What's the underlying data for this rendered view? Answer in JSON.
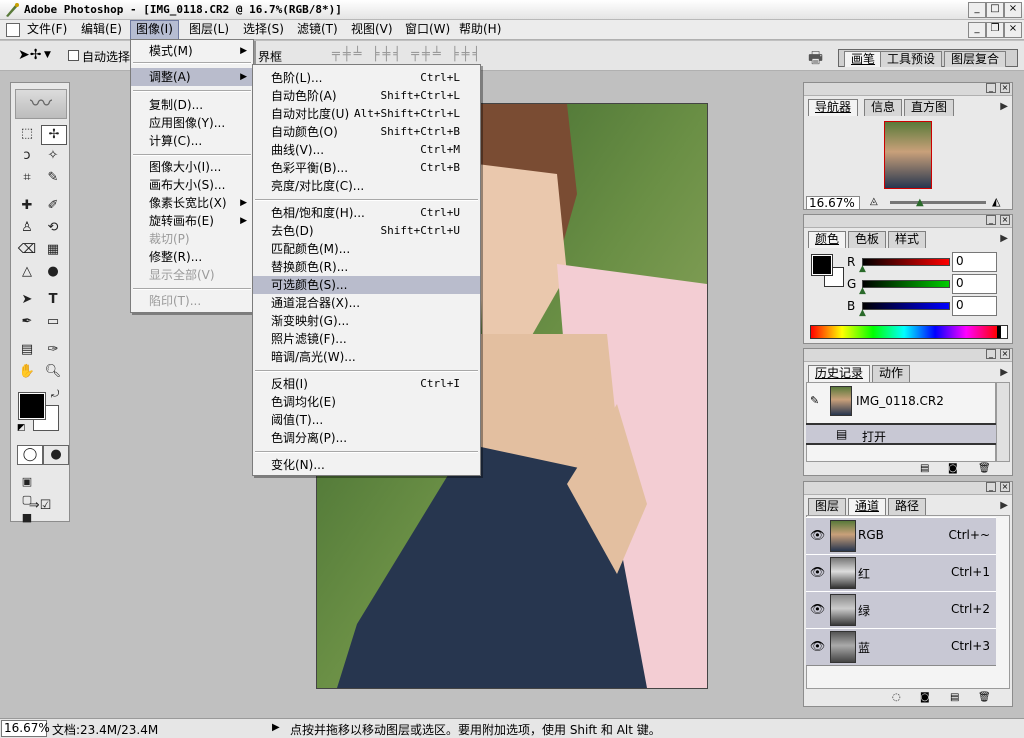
{
  "window": {
    "title": "Adobe Photoshop - [IMG_0118.CR2 @ 16.7%(RGB/8*)]"
  },
  "menubar": [
    {
      "label": "文件(F)"
    },
    {
      "label": "编辑(E)"
    },
    {
      "label": "图像(I)"
    },
    {
      "label": "图层(L)"
    },
    {
      "label": "选择(S)"
    },
    {
      "label": "滤镜(T)"
    },
    {
      "label": "视图(V)"
    },
    {
      "label": "窗口(W)"
    },
    {
      "label": "帮助(H)"
    }
  ],
  "options_bar": {
    "auto_select_label": "自动选择",
    "bounding_box_label": "界框"
  },
  "image_menu": {
    "items": [
      {
        "label": "模式(M)",
        "submenu": true
      },
      {
        "label": "调整(A)",
        "submenu": true,
        "selected": true
      },
      {
        "label": "复制(D)..."
      },
      {
        "label": "应用图像(Y)..."
      },
      {
        "label": "计算(C)..."
      },
      {
        "label": "图像大小(I)..."
      },
      {
        "label": "画布大小(S)..."
      },
      {
        "label": "像素长宽比(X)",
        "submenu": true
      },
      {
        "label": "旋转画布(E)",
        "submenu": true
      },
      {
        "label": "裁切(P)",
        "disabled": true
      },
      {
        "label": "修整(R)..."
      },
      {
        "label": "显示全部(V)",
        "disabled": true
      },
      {
        "label": "陷印(T)...",
        "disabled": true
      }
    ]
  },
  "adjust_menu": {
    "items": [
      {
        "label": "色阶(L)...",
        "shortcut": "Ctrl+L"
      },
      {
        "label": "自动色阶(A)",
        "shortcut": "Shift+Ctrl+L"
      },
      {
        "label": "自动对比度(U)",
        "shortcut": "Alt+Shift+Ctrl+L"
      },
      {
        "label": "自动颜色(O)",
        "shortcut": "Shift+Ctrl+B"
      },
      {
        "label": "曲线(V)...",
        "shortcut": "Ctrl+M"
      },
      {
        "label": "色彩平衡(B)...",
        "shortcut": "Ctrl+B"
      },
      {
        "label": "亮度/对比度(C)..."
      },
      {
        "label": "色相/饱和度(H)...",
        "shortcut": "Ctrl+U"
      },
      {
        "label": "去色(D)",
        "shortcut": "Shift+Ctrl+U"
      },
      {
        "label": "匹配颜色(M)..."
      },
      {
        "label": "替换颜色(R)..."
      },
      {
        "label": "可选颜色(S)...",
        "selected": true
      },
      {
        "label": "通道混合器(X)..."
      },
      {
        "label": "渐变映射(G)..."
      },
      {
        "label": "照片滤镜(F)..."
      },
      {
        "label": "暗调/高光(W)..."
      },
      {
        "label": "反相(I)",
        "shortcut": "Ctrl+I"
      },
      {
        "label": "色调均化(E)"
      },
      {
        "label": "阈值(T)..."
      },
      {
        "label": "色调分离(P)..."
      },
      {
        "label": "变化(N)..."
      }
    ]
  },
  "top_right_tabs": [
    "画笔",
    "工具预设",
    "图层复合"
  ],
  "navigator": {
    "tabs": [
      "导航器",
      "信息",
      "直方图"
    ],
    "zoom": "16.67%"
  },
  "color": {
    "tabs": [
      "颜色",
      "色板",
      "样式"
    ],
    "r_label": "R",
    "g_label": "G",
    "b_label": "B",
    "r": "0",
    "g": "0",
    "b": "0"
  },
  "history": {
    "tabs": [
      "历史记录",
      "动作"
    ],
    "snapshot": "IMG_0118.CR2",
    "step": "打开"
  },
  "channels": {
    "tabs": [
      "图层",
      "通道",
      "路径"
    ],
    "rows": [
      {
        "name": "RGB",
        "shortcut": "Ctrl+~"
      },
      {
        "name": "红",
        "shortcut": "Ctrl+1"
      },
      {
        "name": "绿",
        "shortcut": "Ctrl+2"
      },
      {
        "name": "蓝",
        "shortcut": "Ctrl+3"
      }
    ]
  },
  "status": {
    "zoom": "16.67%",
    "doc": "文档:23.4M/23.4M",
    "hint": "点按并拖移以移动图层或选区。要用附加选项，使用 Shift 和 Alt 键。"
  },
  "colors": {
    "menu_highlight": "#b9bccc",
    "foreground": "#000000",
    "background": "#ffffff"
  }
}
